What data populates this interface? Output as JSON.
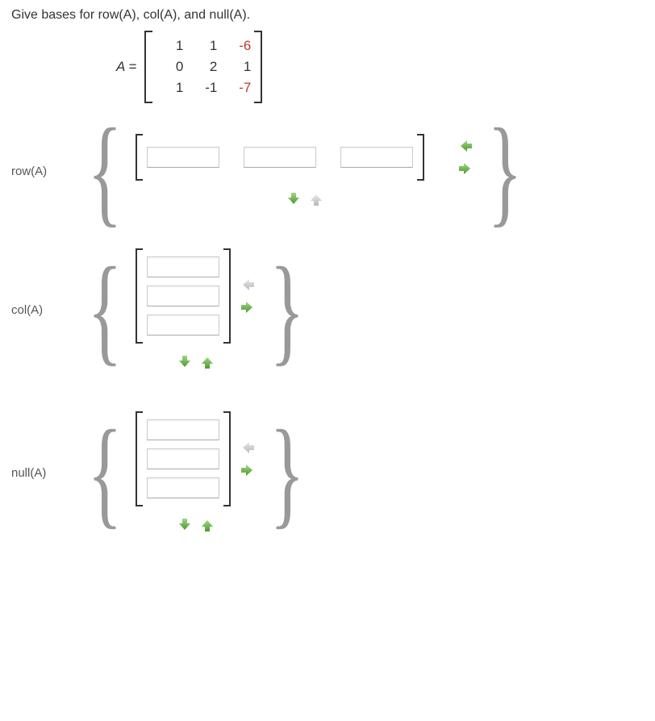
{
  "prompt": "Give bases for row(A), col(A), and null(A).",
  "matrix_label": "A =",
  "A": [
    [
      "1",
      "1",
      "-6"
    ],
    [
      "0",
      "2",
      "1"
    ],
    [
      "1",
      "-1",
      "-7"
    ]
  ],
  "A_red": [
    [
      false,
      false,
      true
    ],
    [
      false,
      false,
      false
    ],
    [
      false,
      false,
      true
    ]
  ],
  "sections": {
    "row": {
      "label": "row(A)"
    },
    "col": {
      "label": "col(A)"
    },
    "null": {
      "label": "null(A)"
    }
  }
}
